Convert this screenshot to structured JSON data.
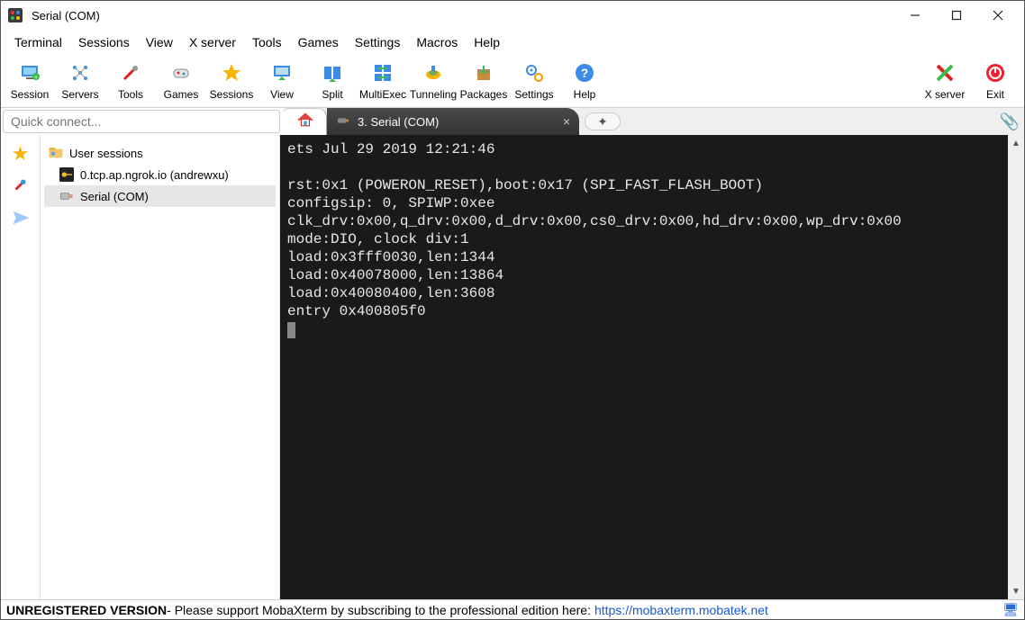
{
  "titlebar": {
    "title": "Serial (COM)"
  },
  "menubar": [
    "Terminal",
    "Sessions",
    "View",
    "X server",
    "Tools",
    "Games",
    "Settings",
    "Macros",
    "Help"
  ],
  "toolbar_left": [
    {
      "label": "Session"
    },
    {
      "label": "Servers"
    },
    {
      "label": "Tools"
    },
    {
      "label": "Games"
    },
    {
      "label": "Sessions"
    },
    {
      "label": "View"
    },
    {
      "label": "Split"
    },
    {
      "label": "MultiExec"
    },
    {
      "label": "Tunneling"
    },
    {
      "label": "Packages"
    },
    {
      "label": "Settings"
    },
    {
      "label": "Help"
    }
  ],
  "toolbar_right": [
    {
      "label": "X server"
    },
    {
      "label": "Exit"
    }
  ],
  "quick_connect_placeholder": "Quick connect...",
  "tabs": {
    "active_label": "3. Serial (COM)"
  },
  "tree": {
    "root": "User sessions",
    "items": [
      "0.tcp.ap.ngrok.io (andrewxu)",
      "Serial (COM)"
    ]
  },
  "terminal_lines": [
    "ets Jul 29 2019 12:21:46",
    "",
    "rst:0x1 (POWERON_RESET),boot:0x17 (SPI_FAST_FLASH_BOOT)",
    "configsip: 0, SPIWP:0xee",
    "clk_drv:0x00,q_drv:0x00,d_drv:0x00,cs0_drv:0x00,hd_drv:0x00,wp_drv:0x00",
    "mode:DIO, clock div:1",
    "load:0x3fff0030,len:1344",
    "load:0x40078000,len:13864",
    "load:0x40080400,len:3608",
    "entry 0x400805f0"
  ],
  "statusbar": {
    "bold": "UNREGISTERED VERSION",
    "text": "  -  Please support MobaXterm by subscribing to the professional edition here:  ",
    "link": "https://mobaxterm.mobatek.net"
  }
}
